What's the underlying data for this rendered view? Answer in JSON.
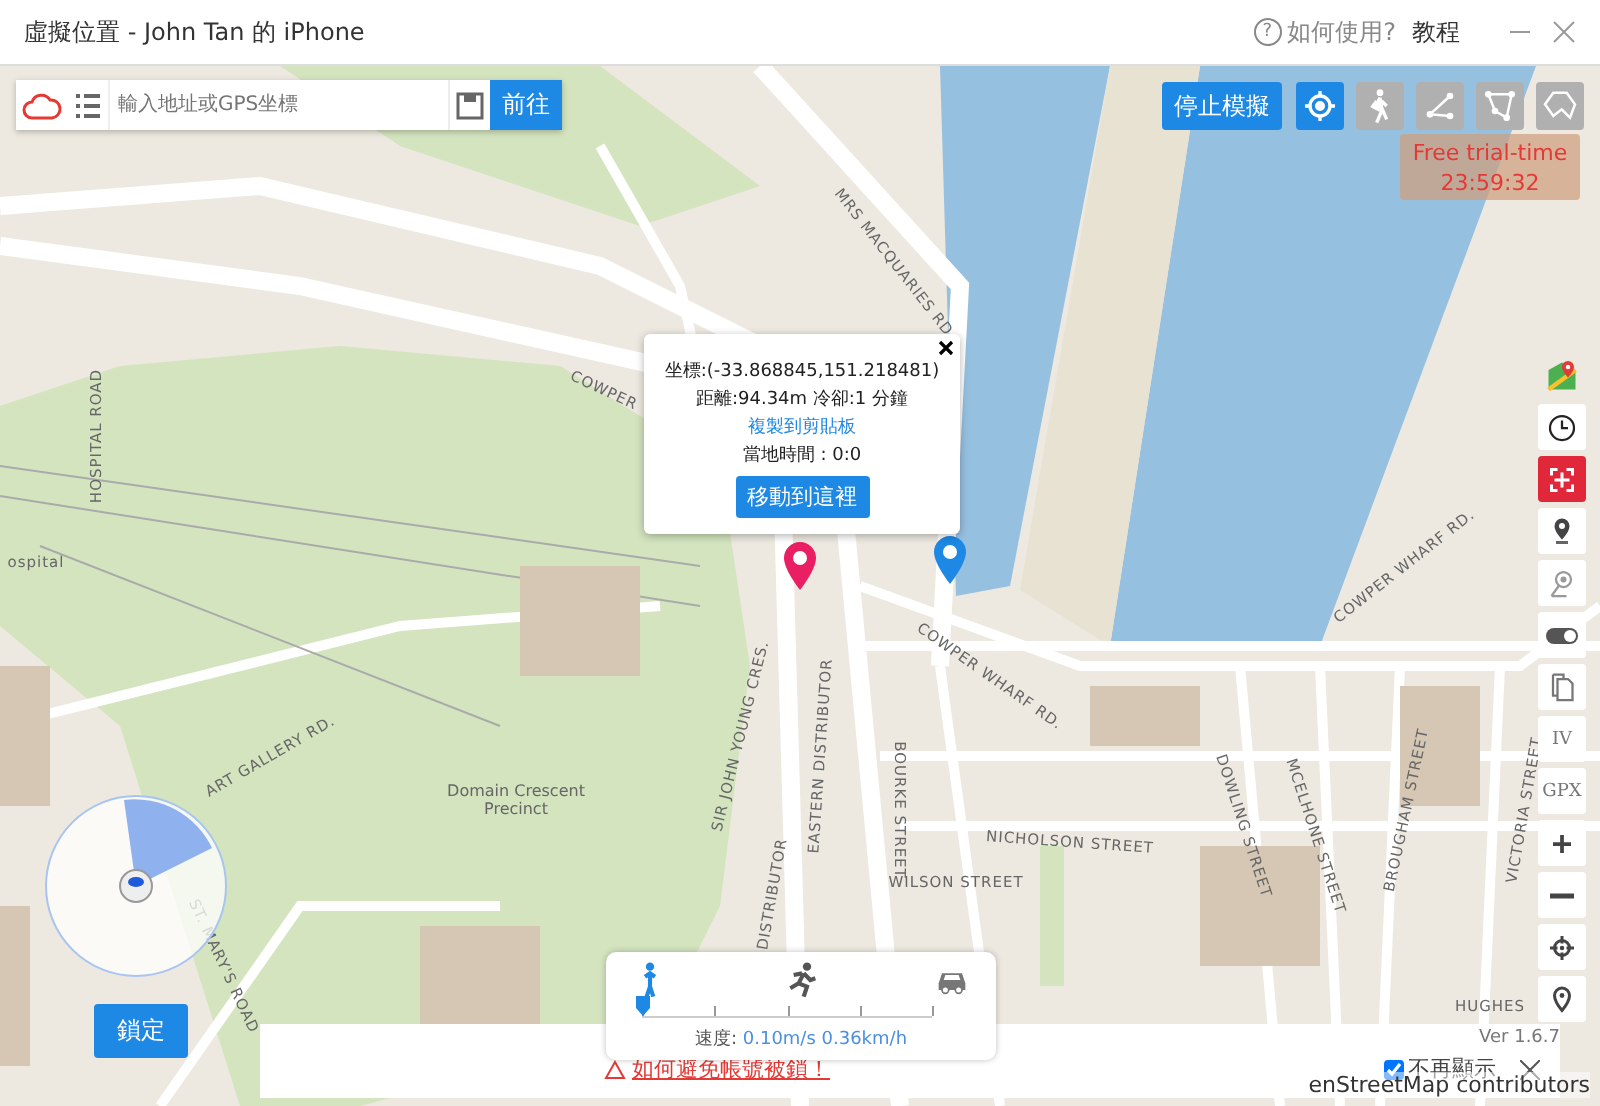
{
  "window": {
    "title": "虛擬位置 - John Tan 的 iPhone",
    "help_icon": "?",
    "help": "如何使用?",
    "tutorial": "教程"
  },
  "search": {
    "placeholder": "輸入地址或GPS坐標",
    "go_button": "前往"
  },
  "stop_button": "停止模擬",
  "modes": [
    {
      "kind": "teleport",
      "selected": true
    },
    {
      "kind": "walk",
      "selected": false
    },
    {
      "kind": "two-spot",
      "selected": false
    },
    {
      "kind": "multi-spot",
      "selected": false
    },
    {
      "kind": "joystick",
      "selected": false
    }
  ],
  "trial": {
    "label": "Free trial-time",
    "time": "23:59:32"
  },
  "popup": {
    "coords": "坐標:(-33.868845,151.218481)",
    "distance": "距離:94.34m 冷卻:1 分鐘",
    "copy_link": "複製到剪貼板",
    "local_time": "當地時間 : 0:0",
    "move_button": "移動到這裡"
  },
  "side_tools": [
    {
      "kind": "maps",
      "on": false
    },
    {
      "kind": "clock",
      "on": false
    },
    {
      "kind": "target",
      "on": true
    },
    {
      "kind": "pin",
      "on": false
    },
    {
      "kind": "pin-off",
      "on": false
    },
    {
      "kind": "toggle",
      "on": false
    },
    {
      "kind": "copy",
      "on": false
    },
    {
      "kind": "text",
      "label": "IV",
      "on": false
    },
    {
      "kind": "text",
      "label": "GPX",
      "on": false
    },
    {
      "kind": "zoom-in",
      "on": false
    },
    {
      "kind": "zoom-out",
      "on": false
    },
    {
      "kind": "crosshair",
      "on": false
    },
    {
      "kind": "location",
      "on": false
    }
  ],
  "lock_button": "鎖定",
  "speed": {
    "modes": [
      {
        "kind": "walk",
        "selected": true
      },
      {
        "kind": "run",
        "selected": false
      },
      {
        "kind": "car",
        "selected": false
      }
    ],
    "level": 0.0,
    "label": "速度:",
    "value": "0.10m/s 0.36km/h"
  },
  "notice": {
    "warning": "如何避免帳號被鎖！",
    "dont_show": {
      "label": "不再顯示",
      "checked": true
    }
  },
  "map": {
    "labels": [
      "MRS MACQUARIES RD",
      "COWPER",
      "HOSPITAL ROAD",
      "ospital",
      "ART GALLERY RD.",
      "Domain Crescent Precinct",
      "SIR JOHN YOUNG CRES.",
      "EASTERN DISTRIBUTOR",
      "BOURKE STREET",
      "NICHOLSON STREET",
      "WILSON STREET",
      "COWPER WHARF RD.",
      "DOWLING STREET",
      "MCELHONE STREET",
      "BROUGHAM STREET",
      "VICTORIA STREET",
      "COWPER WHARF RD.",
      "ST. MARY'S ROAD",
      "DISTRIBUTOR",
      "HUGHES"
    ],
    "version": "Ver 1.6.7",
    "attribution": "enStreetMap contributors"
  }
}
